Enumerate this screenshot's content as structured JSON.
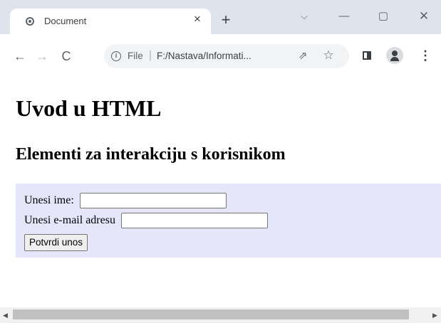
{
  "browser": {
    "tab_title": "Document",
    "new_tab_symbol": "+",
    "window_controls": {
      "chevron": "⌵",
      "minimize": "—",
      "maximize": "▢",
      "close": "✕"
    },
    "tab_close_symbol": "×",
    "nav": {
      "back": "←",
      "forward": "→",
      "reload": "C"
    },
    "address": {
      "scheme_label": "File",
      "separator": "|",
      "url": "F:/Nastava/Informati..."
    },
    "icons": [
      "globe-icon",
      "close-icon",
      "plus-icon",
      "chevron-down-icon",
      "minimize-icon",
      "maximize-icon",
      "window-close-icon",
      "back-icon",
      "forward-icon",
      "reload-icon",
      "info-icon",
      "share-icon",
      "star-icon",
      "side-panel-icon",
      "profile-icon",
      "menu-icon"
    ]
  },
  "page": {
    "heading1": "Uvod u HTML",
    "heading2": "Elementi za interakciju s korisnikom",
    "form": {
      "name_label": "Unesi ime:",
      "name_value": "",
      "email_label": "Unesi e-mail adresu",
      "email_value": "",
      "submit_label": "Potvrdi unos",
      "background_color": "#e6e6fa"
    }
  }
}
